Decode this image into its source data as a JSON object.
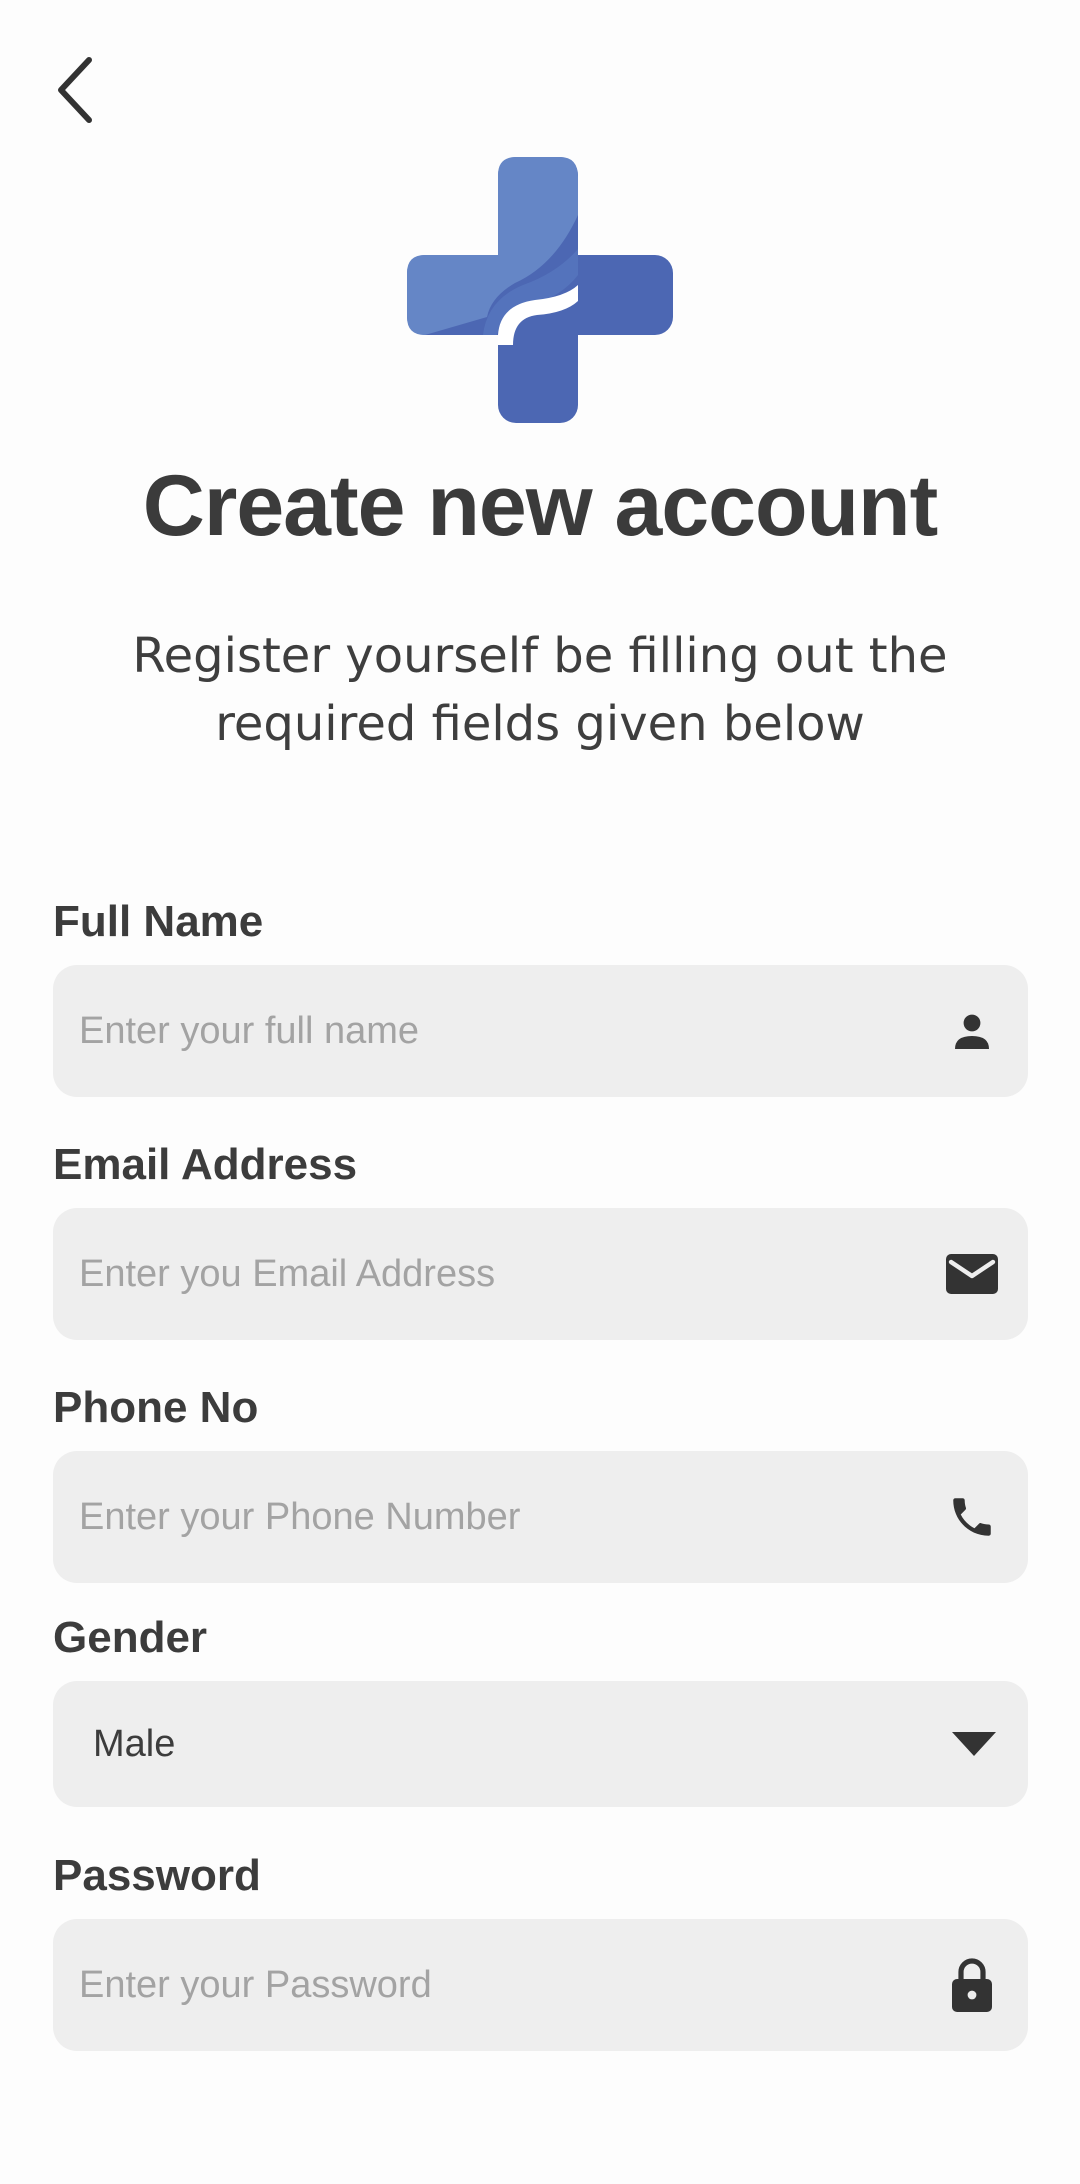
{
  "header": {
    "back_icon": "chevron-left-icon",
    "logo_icon": "medical-cross-logo",
    "brand_colors": {
      "light": "#6586c6",
      "dark": "#4c67b3"
    }
  },
  "title": "Create new account",
  "subtitle": "Register yourself be filling out the required fields given below",
  "form": {
    "full_name": {
      "label": "Full Name",
      "placeholder": "Enter your full name",
      "value": "",
      "icon": "person-icon"
    },
    "email": {
      "label": "Email Address",
      "placeholder": "Enter you Email Address",
      "value": "",
      "icon": "envelope-icon"
    },
    "phone": {
      "label": "Phone No",
      "placeholder": "Enter your Phone Number",
      "value": "",
      "icon": "phone-icon"
    },
    "gender": {
      "label": "Gender",
      "selected": "Male",
      "icon": "caret-down-icon"
    },
    "password": {
      "label": "Password",
      "placeholder": "Enter your Password",
      "value": "",
      "icon": "lock-icon"
    }
  }
}
